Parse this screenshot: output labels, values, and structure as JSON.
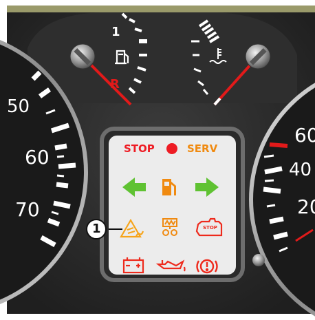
{
  "fuel_gauge": {
    "tick_label": "1",
    "reserve_label": "R",
    "icon": "fuel-pump-icon"
  },
  "temp_gauge": {
    "icon": "coolant-temperature-icon"
  },
  "speedometer": {
    "labels": [
      "50",
      "60",
      "70"
    ]
  },
  "tachometer": {
    "labels": [
      "60",
      "40",
      "20"
    ]
  },
  "warning_panel": {
    "stop_label": "STOP",
    "serv_label": "SERV",
    "stop_engine_text": "STOP",
    "callout_number": "1",
    "lights": [
      {
        "name": "stop-indicator-light",
        "color": "#ee1c24"
      },
      {
        "name": "left-turn-signal-icon",
        "color": "#5fc232"
      },
      {
        "name": "low-fuel-icon",
        "color": "#f08a10"
      },
      {
        "name": "right-turn-signal-icon",
        "color": "#5fc232"
      },
      {
        "name": "esp-skid-warning-icon",
        "color": "#f6a41a"
      },
      {
        "name": "glow-plug-icon",
        "color": "#f08a10"
      },
      {
        "name": "engine-warning-icon",
        "color": "#ee2a1c"
      },
      {
        "name": "battery-charge-icon",
        "color": "#ee2a1c"
      },
      {
        "name": "oil-pressure-icon",
        "color": "#ee2a1c"
      },
      {
        "name": "brake-warning-icon",
        "color": "#ee2a1c"
      }
    ]
  }
}
